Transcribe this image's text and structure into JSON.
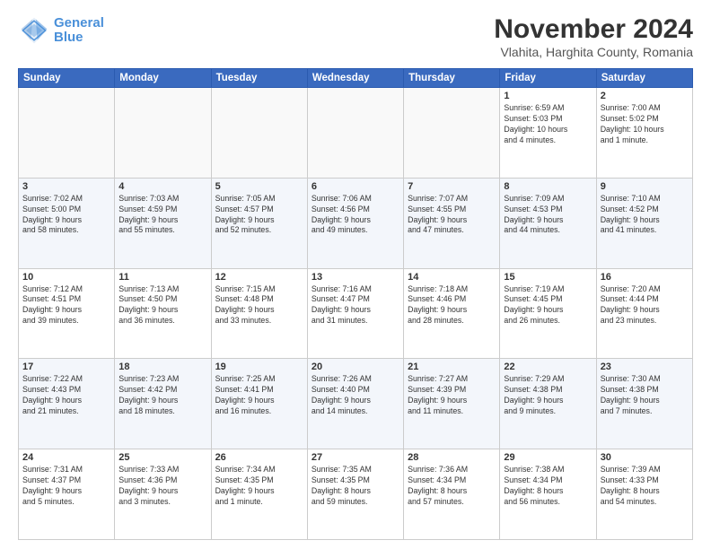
{
  "header": {
    "logo_line1": "General",
    "logo_line2": "Blue",
    "month": "November 2024",
    "location": "Vlahita, Harghita County, Romania"
  },
  "weekdays": [
    "Sunday",
    "Monday",
    "Tuesday",
    "Wednesday",
    "Thursday",
    "Friday",
    "Saturday"
  ],
  "weeks": [
    [
      {
        "day": "",
        "info": ""
      },
      {
        "day": "",
        "info": ""
      },
      {
        "day": "",
        "info": ""
      },
      {
        "day": "",
        "info": ""
      },
      {
        "day": "",
        "info": ""
      },
      {
        "day": "1",
        "info": "Sunrise: 6:59 AM\nSunset: 5:03 PM\nDaylight: 10 hours\nand 4 minutes."
      },
      {
        "day": "2",
        "info": "Sunrise: 7:00 AM\nSunset: 5:02 PM\nDaylight: 10 hours\nand 1 minute."
      }
    ],
    [
      {
        "day": "3",
        "info": "Sunrise: 7:02 AM\nSunset: 5:00 PM\nDaylight: 9 hours\nand 58 minutes."
      },
      {
        "day": "4",
        "info": "Sunrise: 7:03 AM\nSunset: 4:59 PM\nDaylight: 9 hours\nand 55 minutes."
      },
      {
        "day": "5",
        "info": "Sunrise: 7:05 AM\nSunset: 4:57 PM\nDaylight: 9 hours\nand 52 minutes."
      },
      {
        "day": "6",
        "info": "Sunrise: 7:06 AM\nSunset: 4:56 PM\nDaylight: 9 hours\nand 49 minutes."
      },
      {
        "day": "7",
        "info": "Sunrise: 7:07 AM\nSunset: 4:55 PM\nDaylight: 9 hours\nand 47 minutes."
      },
      {
        "day": "8",
        "info": "Sunrise: 7:09 AM\nSunset: 4:53 PM\nDaylight: 9 hours\nand 44 minutes."
      },
      {
        "day": "9",
        "info": "Sunrise: 7:10 AM\nSunset: 4:52 PM\nDaylight: 9 hours\nand 41 minutes."
      }
    ],
    [
      {
        "day": "10",
        "info": "Sunrise: 7:12 AM\nSunset: 4:51 PM\nDaylight: 9 hours\nand 39 minutes."
      },
      {
        "day": "11",
        "info": "Sunrise: 7:13 AM\nSunset: 4:50 PM\nDaylight: 9 hours\nand 36 minutes."
      },
      {
        "day": "12",
        "info": "Sunrise: 7:15 AM\nSunset: 4:48 PM\nDaylight: 9 hours\nand 33 minutes."
      },
      {
        "day": "13",
        "info": "Sunrise: 7:16 AM\nSunset: 4:47 PM\nDaylight: 9 hours\nand 31 minutes."
      },
      {
        "day": "14",
        "info": "Sunrise: 7:18 AM\nSunset: 4:46 PM\nDaylight: 9 hours\nand 28 minutes."
      },
      {
        "day": "15",
        "info": "Sunrise: 7:19 AM\nSunset: 4:45 PM\nDaylight: 9 hours\nand 26 minutes."
      },
      {
        "day": "16",
        "info": "Sunrise: 7:20 AM\nSunset: 4:44 PM\nDaylight: 9 hours\nand 23 minutes."
      }
    ],
    [
      {
        "day": "17",
        "info": "Sunrise: 7:22 AM\nSunset: 4:43 PM\nDaylight: 9 hours\nand 21 minutes."
      },
      {
        "day": "18",
        "info": "Sunrise: 7:23 AM\nSunset: 4:42 PM\nDaylight: 9 hours\nand 18 minutes."
      },
      {
        "day": "19",
        "info": "Sunrise: 7:25 AM\nSunset: 4:41 PM\nDaylight: 9 hours\nand 16 minutes."
      },
      {
        "day": "20",
        "info": "Sunrise: 7:26 AM\nSunset: 4:40 PM\nDaylight: 9 hours\nand 14 minutes."
      },
      {
        "day": "21",
        "info": "Sunrise: 7:27 AM\nSunset: 4:39 PM\nDaylight: 9 hours\nand 11 minutes."
      },
      {
        "day": "22",
        "info": "Sunrise: 7:29 AM\nSunset: 4:38 PM\nDaylight: 9 hours\nand 9 minutes."
      },
      {
        "day": "23",
        "info": "Sunrise: 7:30 AM\nSunset: 4:38 PM\nDaylight: 9 hours\nand 7 minutes."
      }
    ],
    [
      {
        "day": "24",
        "info": "Sunrise: 7:31 AM\nSunset: 4:37 PM\nDaylight: 9 hours\nand 5 minutes."
      },
      {
        "day": "25",
        "info": "Sunrise: 7:33 AM\nSunset: 4:36 PM\nDaylight: 9 hours\nand 3 minutes."
      },
      {
        "day": "26",
        "info": "Sunrise: 7:34 AM\nSunset: 4:35 PM\nDaylight: 9 hours\nand 1 minute."
      },
      {
        "day": "27",
        "info": "Sunrise: 7:35 AM\nSunset: 4:35 PM\nDaylight: 8 hours\nand 59 minutes."
      },
      {
        "day": "28",
        "info": "Sunrise: 7:36 AM\nSunset: 4:34 PM\nDaylight: 8 hours\nand 57 minutes."
      },
      {
        "day": "29",
        "info": "Sunrise: 7:38 AM\nSunset: 4:34 PM\nDaylight: 8 hours\nand 56 minutes."
      },
      {
        "day": "30",
        "info": "Sunrise: 7:39 AM\nSunset: 4:33 PM\nDaylight: 8 hours\nand 54 minutes."
      }
    ]
  ]
}
